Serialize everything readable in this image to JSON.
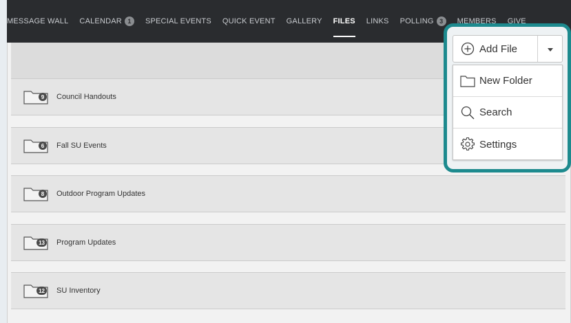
{
  "nav": {
    "items": [
      {
        "label": "MESSAGE WALL"
      },
      {
        "label": "CALENDAR",
        "badge": "1"
      },
      {
        "label": "SPECIAL EVENTS"
      },
      {
        "label": "QUICK EVENT"
      },
      {
        "label": "GALLERY"
      },
      {
        "label": "FILES",
        "active": true
      },
      {
        "label": "LINKS"
      },
      {
        "label": "POLLING",
        "badge": "3"
      },
      {
        "label": "MEMBERS"
      },
      {
        "label": "GIVE"
      }
    ]
  },
  "folders": [
    {
      "name": "Council Handouts",
      "count": "9"
    },
    {
      "name": "Fall SU Events",
      "count": "6"
    },
    {
      "name": "Outdoor Program Updates",
      "count": "8"
    },
    {
      "name": "Program Updates",
      "count": "13"
    },
    {
      "name": "SU Inventory",
      "count": "12"
    }
  ],
  "toolbar": {
    "add_file_label": "Add File"
  },
  "menu": {
    "items": [
      {
        "label": "New Folder",
        "icon": "folder-icon"
      },
      {
        "label": "Search",
        "icon": "search-icon"
      },
      {
        "label": "Settings",
        "icon": "gear-icon"
      }
    ]
  },
  "colors": {
    "highlight": "#1d8a8e",
    "navbar": "#2a2c2f"
  }
}
